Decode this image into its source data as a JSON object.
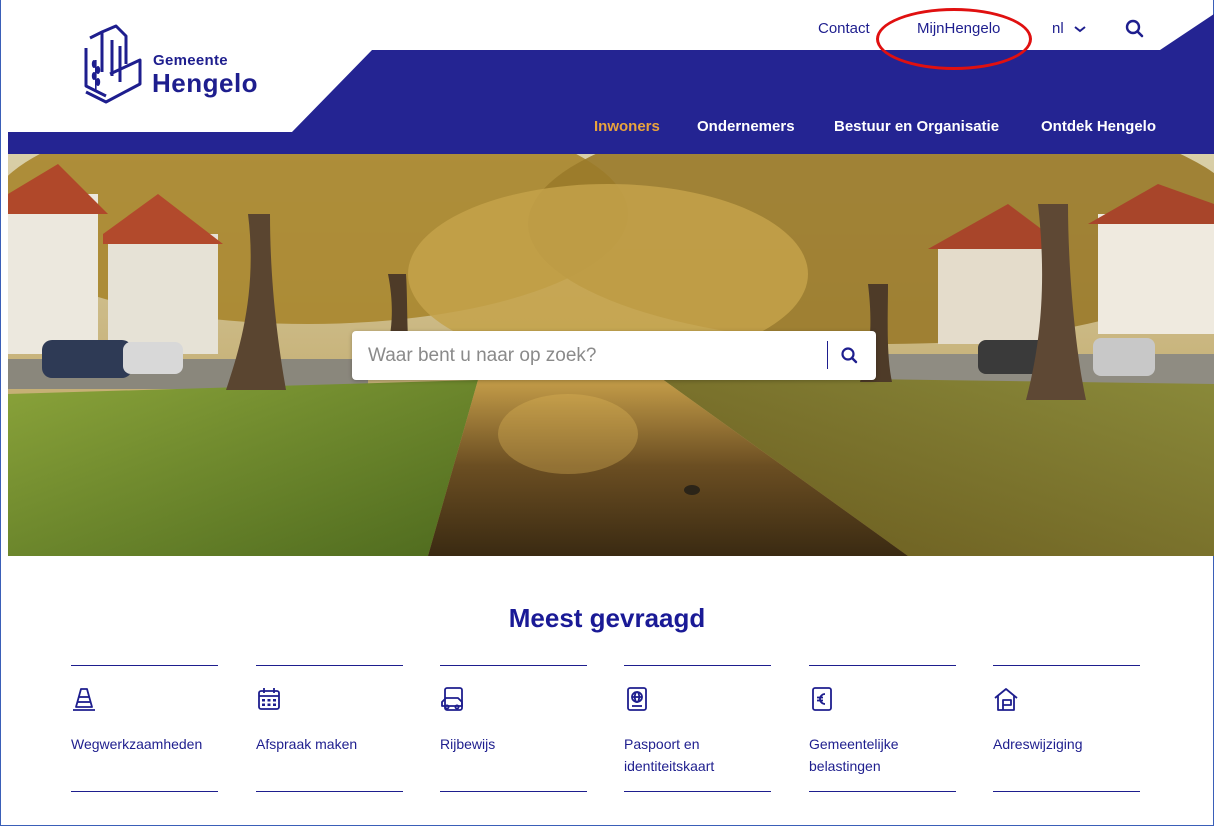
{
  "logo": {
    "small": "Gemeente",
    "big": "Hengelo"
  },
  "topnav": {
    "contact": "Contact",
    "mijn": "MijnHengelo",
    "lang": "nl",
    "lang_icon": "chevron-down-icon",
    "search_icon": "search-icon"
  },
  "mainnav": [
    {
      "label": "Inwoners",
      "active": true
    },
    {
      "label": "Ondernemers",
      "active": false
    },
    {
      "label": "Bestuur en Organisatie",
      "active": false
    },
    {
      "label": "Ontdek Hengelo",
      "active": false
    }
  ],
  "search": {
    "placeholder": "Waar bent u naar op zoek?"
  },
  "section": {
    "title": "Meest gevraagd"
  },
  "tiles": [
    {
      "label": "Wegwerkzaamheden",
      "icon": "traffic-cone-icon"
    },
    {
      "label": "Afspraak maken",
      "icon": "calendar-icon"
    },
    {
      "label": "Rijbewijs",
      "icon": "drivers-license-icon"
    },
    {
      "label": "Paspoort en identiteitskaart",
      "icon": "passport-icon"
    },
    {
      "label": "Gemeentelijke belastingen",
      "icon": "tax-document-icon"
    },
    {
      "label": "Adreswijziging",
      "icon": "house-icon"
    }
  ],
  "colors": {
    "brand_navy": "#1e1e8e",
    "active_nav": "#e8a33d",
    "annotation_red": "#e01010"
  }
}
